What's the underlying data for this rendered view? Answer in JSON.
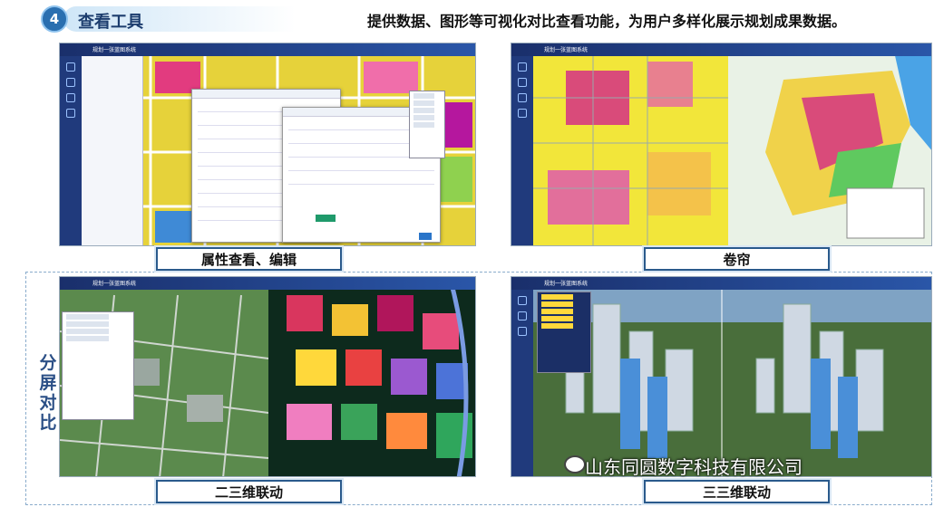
{
  "header": {
    "badge": "4",
    "title": "查看工具",
    "description": "提供数据、图形等可视化对比查看功能，为用户多样化展示规划成果数据。"
  },
  "captions": {
    "attribute": "属性查看、编辑",
    "curtain": "卷帘",
    "two_three": "二三维联动",
    "three_three": "三三维联动"
  },
  "split_label": "分屏对比",
  "app": {
    "title": "规划一张蓝图系统"
  },
  "watermark": "山东同圆数字科技有限公司"
}
